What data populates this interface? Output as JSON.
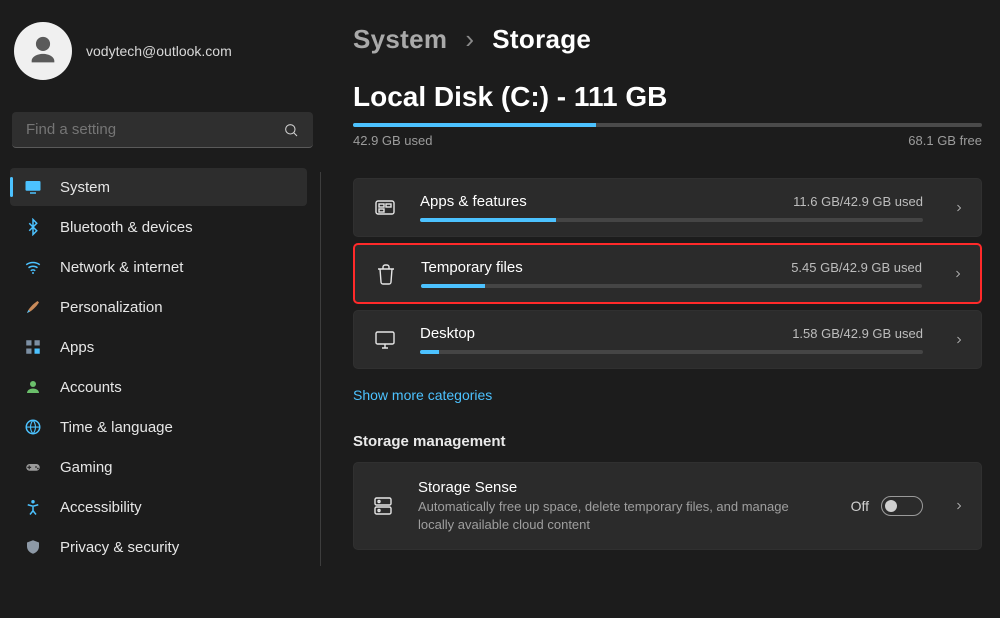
{
  "user": {
    "email": "vodytech@outlook.com"
  },
  "search": {
    "placeholder": "Find a setting"
  },
  "nav": {
    "items": [
      {
        "label": "System"
      },
      {
        "label": "Bluetooth & devices"
      },
      {
        "label": "Network & internet"
      },
      {
        "label": "Personalization"
      },
      {
        "label": "Apps"
      },
      {
        "label": "Accounts"
      },
      {
        "label": "Time & language"
      },
      {
        "label": "Gaming"
      },
      {
        "label": "Accessibility"
      },
      {
        "label": "Privacy & security"
      }
    ]
  },
  "breadcrumb": {
    "parent": "System",
    "sep": "›",
    "current": "Storage"
  },
  "disk": {
    "title": "Local Disk (C:) - 111 GB",
    "used": "42.9 GB used",
    "free": "68.1 GB free",
    "fill_pct": 38.6
  },
  "categories": [
    {
      "title": "Apps & features",
      "used": "11.6 GB/42.9 GB used",
      "fill_pct": 27.0,
      "icon": "apps"
    },
    {
      "title": "Temporary files",
      "used": "5.45 GB/42.9 GB used",
      "fill_pct": 12.7,
      "icon": "trash",
      "highlight": true
    },
    {
      "title": "Desktop",
      "used": "1.58 GB/42.9 GB used",
      "fill_pct": 3.7,
      "icon": "desktop"
    }
  ],
  "show_more": "Show more categories",
  "section": "Storage management",
  "sense": {
    "title": "Storage Sense",
    "desc": "Automatically free up space, delete temporary files, and manage locally available cloud content",
    "state": "Off"
  }
}
